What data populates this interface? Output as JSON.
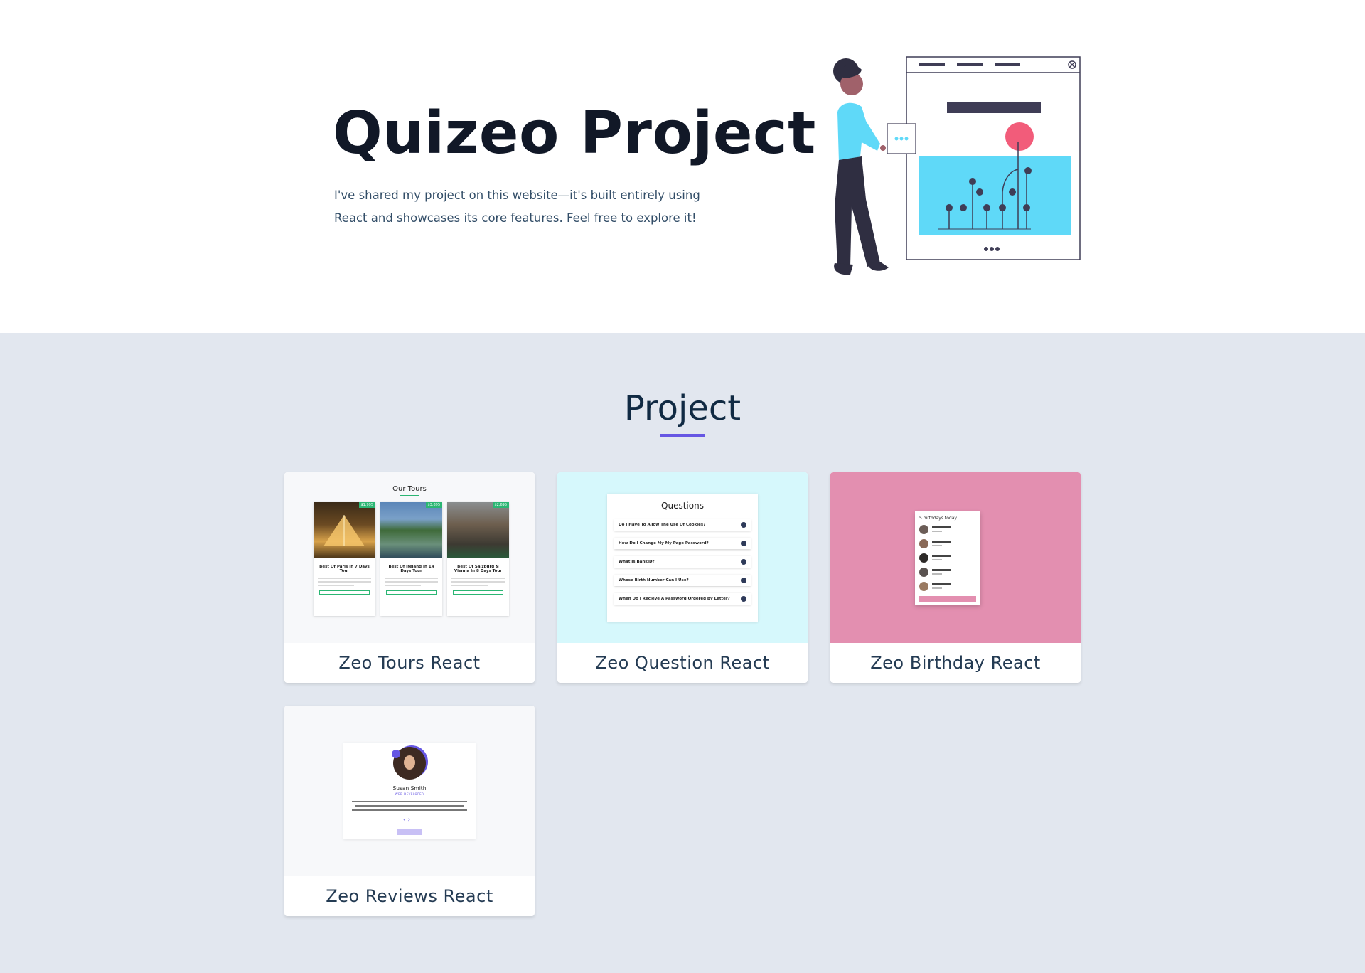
{
  "hero": {
    "title": "Quizeo Project",
    "description": "I've shared my project on this website—it's built entirely using React and showcases its core features. Feel free to explore it!"
  },
  "projects_section": {
    "title": "Project",
    "accent_color": "#6657e3"
  },
  "projects": [
    {
      "title": "Zeo Tours React",
      "thumb_bg": "#f7f8fa"
    },
    {
      "title": "Zeo Question React",
      "thumb_bg": "#d6f8fc"
    },
    {
      "title": "Zeo Birthday React",
      "thumb_bg": "#e38fb0"
    },
    {
      "title": "Zeo Reviews React",
      "thumb_bg": "#f7f8fa"
    }
  ],
  "previews": {
    "tours": {
      "heading": "Our Tours",
      "items": [
        {
          "name": "Best Of Paris In 7 Days Tour",
          "price": "$1,995"
        },
        {
          "name": "Best Of Ireland In 14 Days Tour",
          "price": "$3,895"
        },
        {
          "name": "Best Of Salzburg & Vienna In 8 Days Tour",
          "price": "$2,695"
        }
      ]
    },
    "questions": {
      "heading": "Questions",
      "items": [
        "Do I Have To Allow The Use Of Cookies?",
        "How Do I Change My My Page Password?",
        "What Is BankID?",
        "Whose Birth Number Can I Use?",
        "When Do I Recieve A Password Ordered By Letter?"
      ]
    },
    "birthday": {
      "heading": "5 birthdays today"
    },
    "reviews": {
      "name": "Susan Smith",
      "job": "WEB DEVELOPER"
    }
  }
}
